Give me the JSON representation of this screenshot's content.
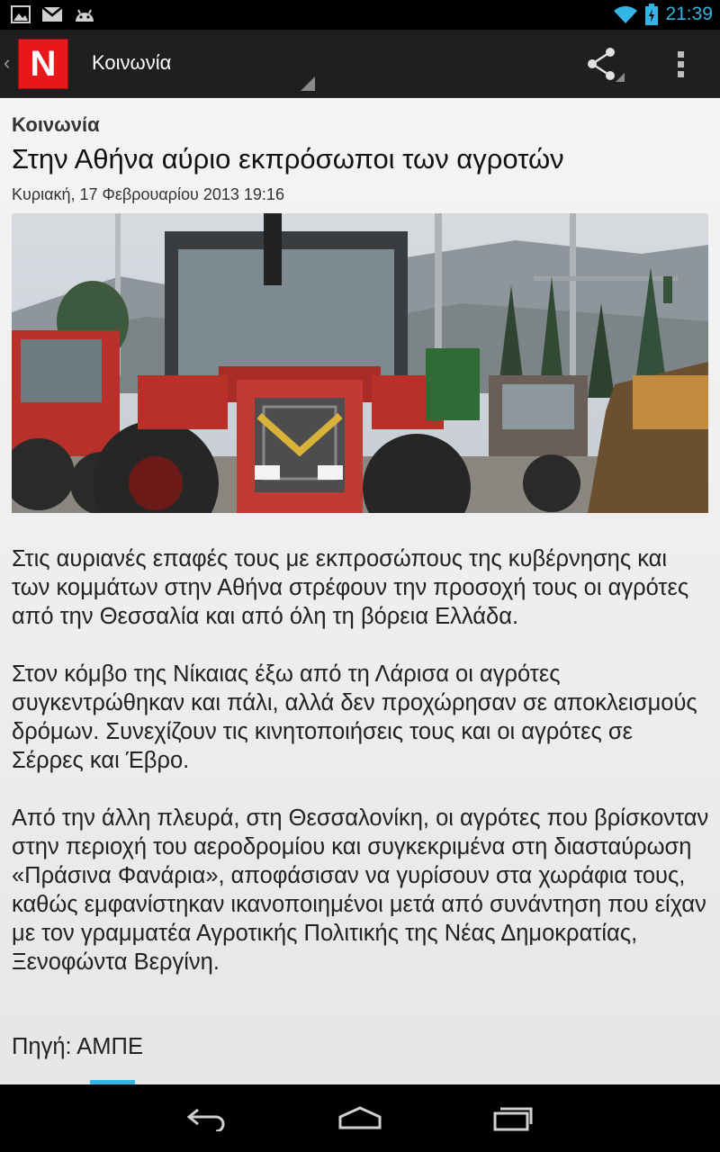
{
  "status_bar": {
    "time": "21:39",
    "icons": [
      "image-icon",
      "gmail-icon",
      "android-icon",
      "wifi-icon",
      "battery-charging-icon"
    ]
  },
  "action_bar": {
    "app_logo_letter": "N",
    "section_title": "Κοινωνία",
    "actions": [
      "share-icon",
      "overflow-menu-icon"
    ]
  },
  "article": {
    "category": "Κοινωνία",
    "title": "Στην Αθήνα αύριο εκπρόσωποι των αγροτών",
    "date": "Κυριακή, 17 Φεβρουαρίου 2013 19:16",
    "photo_description": "tractors-protest-photo",
    "paragraphs": [
      "Στις αυριανές επαφές τους με εκπροσώπους της κυβέρνησης και των κομμάτων στην Αθήνα στρέφουν την προσοχή τους οι αγρότες από την Θεσσαλία και από όλη τη βόρεια Ελλάδα.",
      "Στον κόμβο της Νίκαιας έξω από τη Λάρισα οι αγρότες συγκεντρώθηκαν και πάλι, αλλά δεν προχώρησαν σε αποκλεισμούς δρόμων. Συνεχίζουν τις κινητοποιήσεις τους και οι αγρότες σε Σέρρες και Έβρο.",
      "Από την άλλη πλευρά, στη Θεσσαλονίκη, οι αγρότες που βρίσκονταν στην περιοχή του αεροδρομίου και συγκεκριμένα στη διασταύρωση «Πράσινα Φανάρια», αποφάσισαν να γυρίσουν στα χωράφια τους, καθώς εμφανίστηκαν ικανοποιημένοι μετά από συνάντηση που είχαν με τον γραμματέα Αγροτικής Πολιτικής της Νέας Δημοκρατίας, Ξενοφώντα Βεργίνη."
    ],
    "source": "Πηγή: ΑΜΠΕ"
  },
  "nav_bar": {
    "buttons": [
      "back-icon",
      "home-icon",
      "recent-apps-icon"
    ]
  },
  "colors": {
    "accent": "#33b5e5",
    "logo_red": "#e8171c",
    "action_bar": "#1f1f1f"
  }
}
